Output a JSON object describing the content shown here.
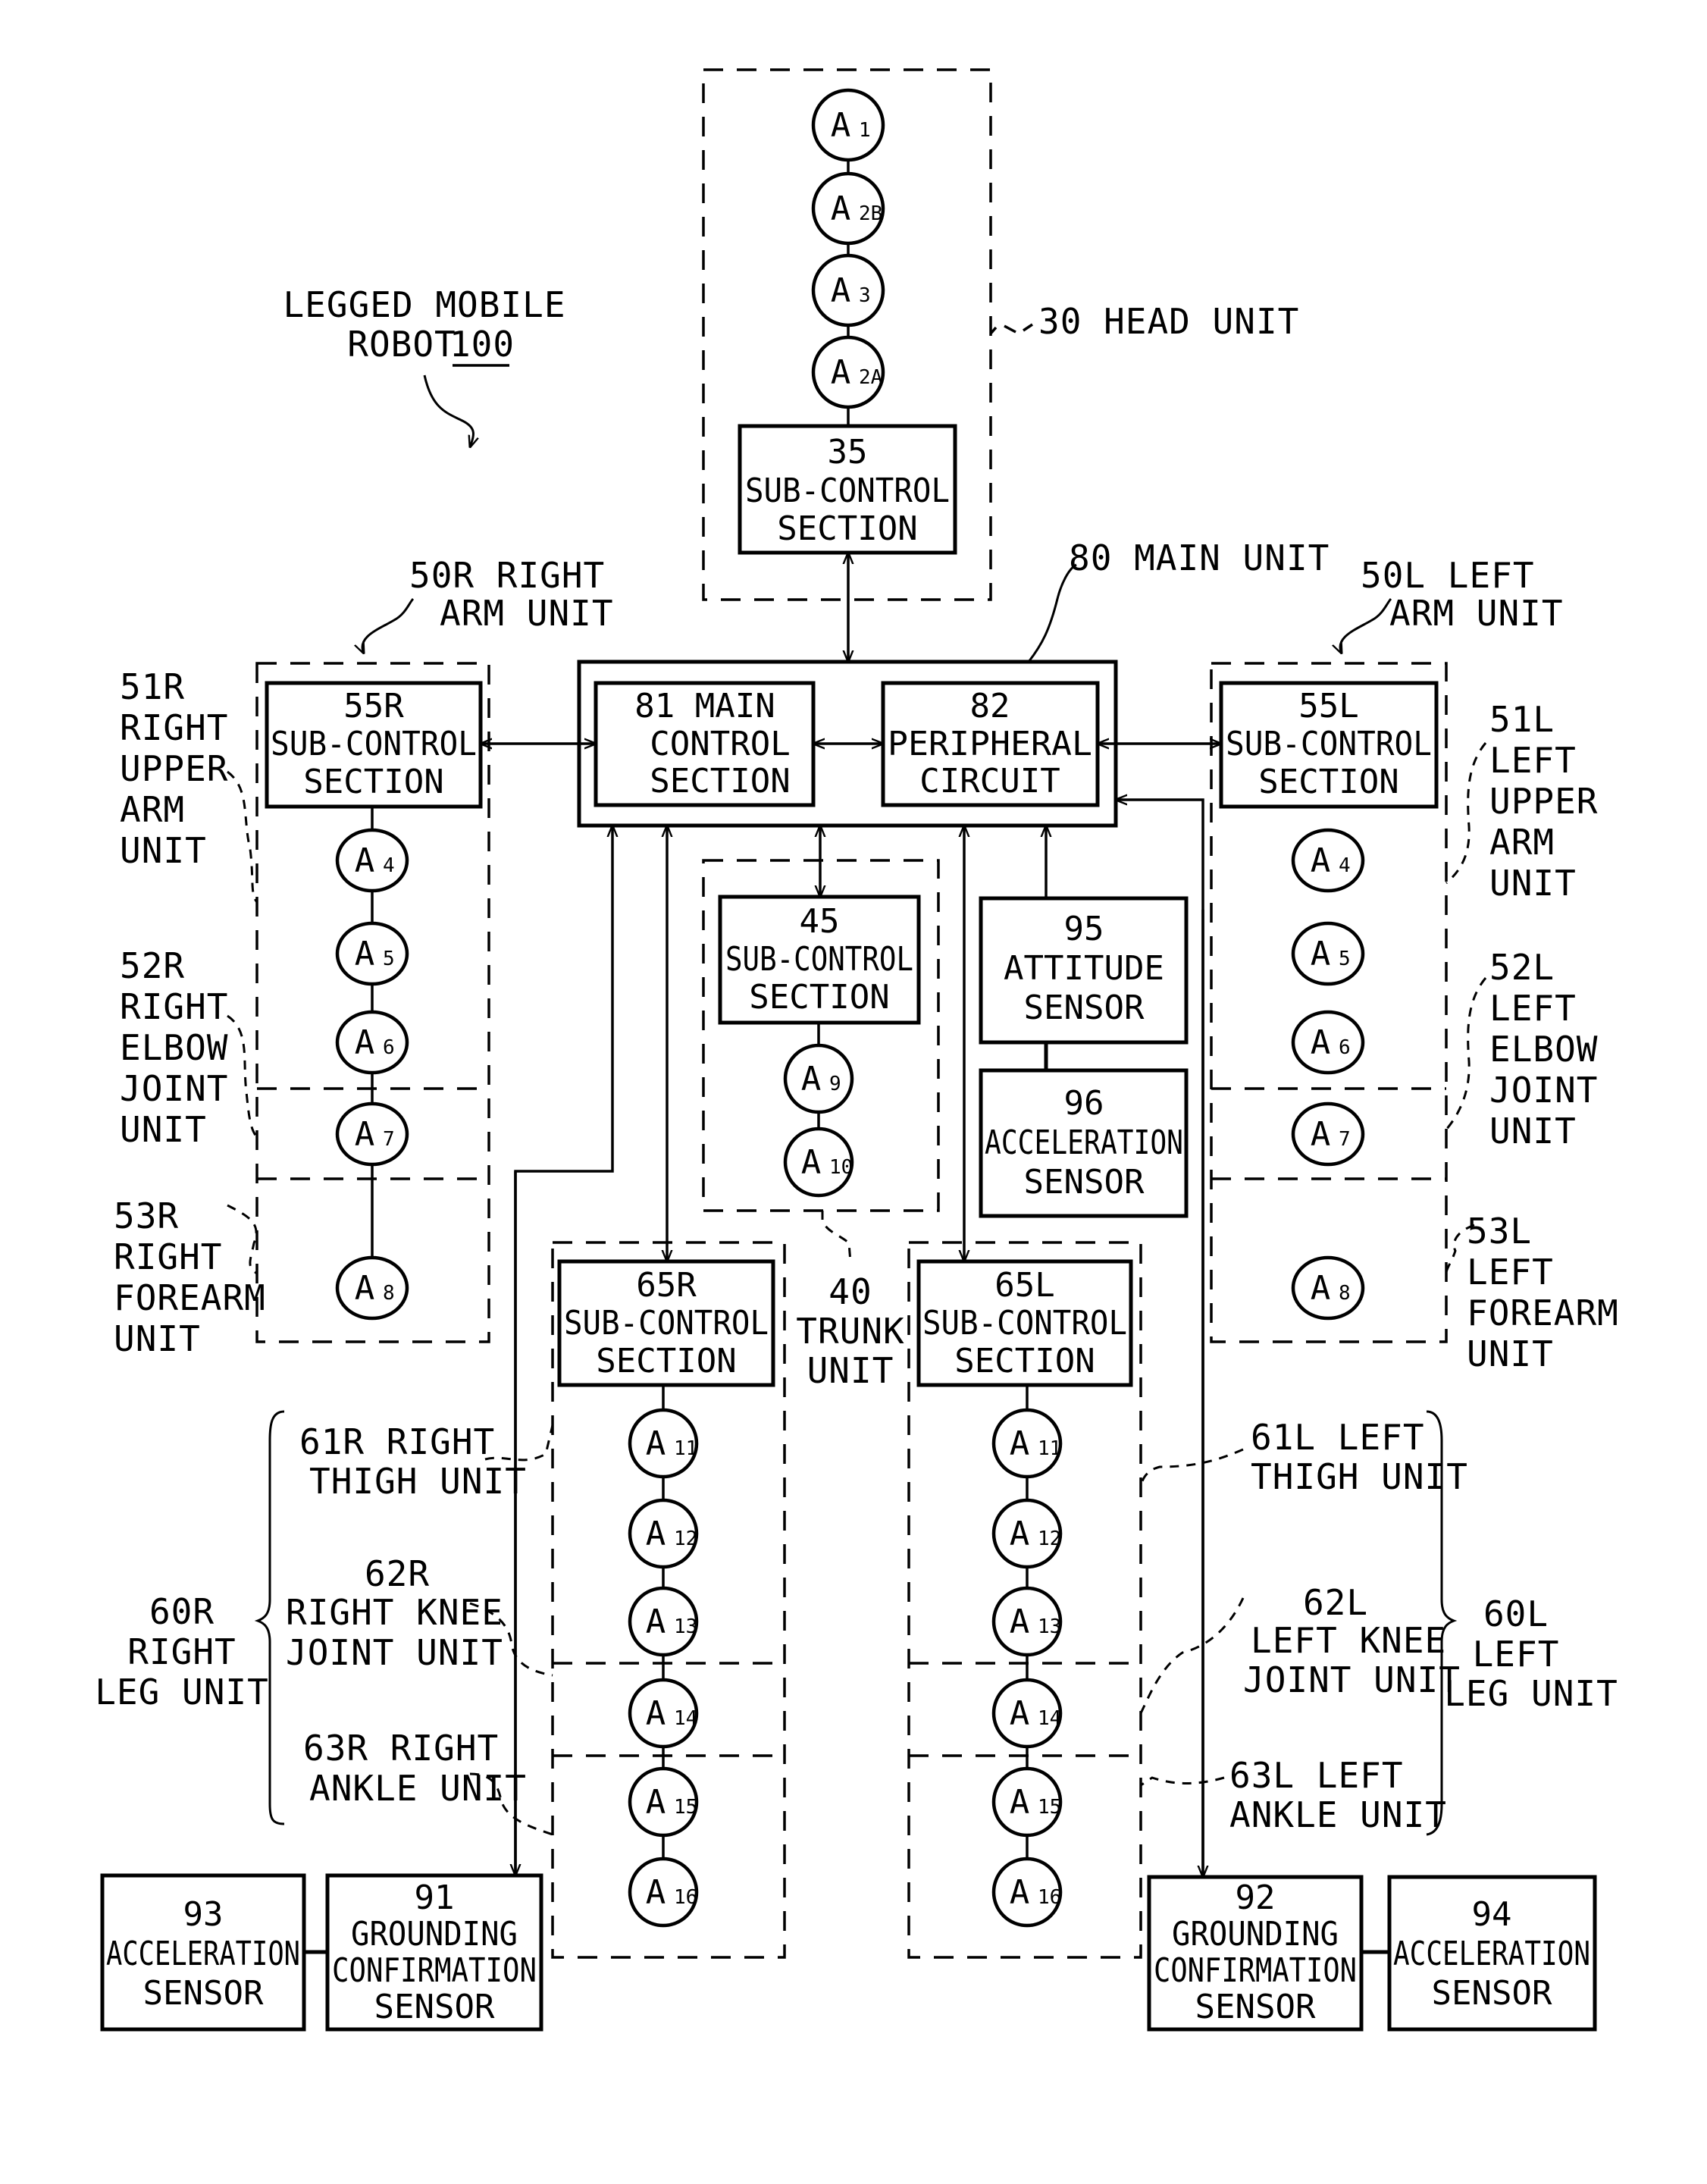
{
  "figure": {
    "title_line1": "LEGGED MOBILE",
    "title_line2": "ROBOT",
    "title_ref": "100"
  },
  "units": {
    "head": "30 HEAD UNIT",
    "main": "80 MAIN UNIT",
    "right_arm": [
      "50R RIGHT",
      "ARM UNIT"
    ],
    "left_arm": [
      "50L LEFT",
      "ARM UNIT"
    ],
    "trunk": [
      "40",
      "TRUNK",
      "UNIT"
    ],
    "right_upper_arm": [
      "51R",
      "RIGHT",
      "UPPER",
      "ARM",
      "UNIT"
    ],
    "right_elbow": [
      "52R",
      "RIGHT",
      "ELBOW",
      "JOINT",
      "UNIT"
    ],
    "right_forearm": [
      "53R",
      "RIGHT",
      "FOREARM",
      "UNIT"
    ],
    "left_upper_arm": [
      "51L",
      "LEFT",
      "UPPER",
      "ARM",
      "UNIT"
    ],
    "left_elbow": [
      "52L",
      "LEFT",
      "ELBOW",
      "JOINT",
      "UNIT"
    ],
    "left_forearm": [
      "53L",
      "LEFT",
      "FOREARM",
      "UNIT"
    ],
    "right_thigh": [
      "61R RIGHT",
      "THIGH UNIT"
    ],
    "right_knee": [
      "62R",
      "RIGHT KNEE",
      "JOINT UNIT"
    ],
    "right_ankle": [
      "63R RIGHT",
      "ANKLE UNIT"
    ],
    "right_leg": [
      "60R",
      "RIGHT",
      "LEG UNIT"
    ],
    "left_thigh": [
      "61L LEFT",
      "THIGH UNIT"
    ],
    "left_knee": [
      "62L",
      "LEFT KNEE",
      "JOINT UNIT"
    ],
    "left_ankle": [
      "63L LEFT",
      "ANKLE UNIT"
    ],
    "left_leg": [
      "60L",
      "LEFT",
      "LEG UNIT"
    ]
  },
  "boxes": {
    "b35": [
      "35",
      "SUB-CONTROL",
      "SECTION"
    ],
    "b81": [
      "81 MAIN",
      "CONTROL",
      "SECTION"
    ],
    "b82": [
      "82",
      "PERIPHERAL",
      "CIRCUIT"
    ],
    "b55R": [
      "55R",
      "SUB-CONTROL",
      "SECTION"
    ],
    "b55L": [
      "55L",
      "SUB-CONTROL",
      "SECTION"
    ],
    "b45": [
      "45",
      "SUB-CONTROL",
      "SECTION"
    ],
    "b95": [
      "95",
      "ATTITUDE",
      "SENSOR"
    ],
    "b96": [
      "96",
      "ACCELERATION",
      "SENSOR"
    ],
    "b65R": [
      "65R",
      "SUB-CONTROL",
      "SECTION"
    ],
    "b65L": [
      "65L",
      "SUB-CONTROL",
      "SECTION"
    ],
    "b91": [
      "91",
      "GROUNDING",
      "CONFIRMATION",
      "SENSOR"
    ],
    "b92": [
      "92",
      "GROUNDING",
      "CONFIRMATION",
      "SENSOR"
    ],
    "b93": [
      "93",
      "ACCELERATION",
      "SENSOR"
    ],
    "b94": [
      "94",
      "ACCELERATION",
      "SENSOR"
    ]
  },
  "actuators": {
    "letter": "A",
    "head": [
      "1",
      "2B",
      "3",
      "2A"
    ],
    "right_arm": [
      "4",
      "5",
      "6",
      "7",
      "8"
    ],
    "left_arm": [
      "4",
      "5",
      "6",
      "7",
      "8"
    ],
    "trunk": [
      "9",
      "10"
    ],
    "right_leg": [
      "11",
      "12",
      "13",
      "14",
      "15",
      "16"
    ],
    "left_leg": [
      "11",
      "12",
      "13",
      "14",
      "15",
      "16"
    ]
  }
}
